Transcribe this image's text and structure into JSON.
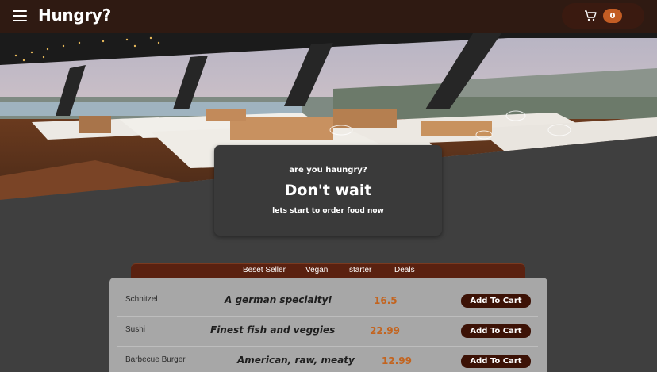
{
  "header": {
    "brand": "Hungry?",
    "menu_icon": "hamburger-menu-icon",
    "cart_icon": "shopping-cart-icon",
    "cart_count": "0"
  },
  "promo": {
    "subtitle": "are you haungry?",
    "title": "Don't wait",
    "tagline": "lets start to order food now"
  },
  "tabs": [
    {
      "label": "Beset Seller"
    },
    {
      "label": "Vegan"
    },
    {
      "label": "starter"
    },
    {
      "label": "Deals"
    }
  ],
  "menu": {
    "items": [
      {
        "name": "Schnitzel",
        "description": "A german specialty!",
        "price": "16.5",
        "button": "Add To Cart"
      },
      {
        "name": "Sushi",
        "description": "Finest fish and veggies",
        "price": "22.99",
        "button": "Add To Cart"
      },
      {
        "name": "Barbecue Burger",
        "description": "American, raw, meaty",
        "price": "12.99",
        "button": "Add To Cart"
      }
    ]
  },
  "colors": {
    "header_bg": "#2f1a12",
    "accent": "#c35d24",
    "tab_bar": "#5a2110",
    "button_bg": "#3c1206",
    "price": "#c3641f"
  }
}
